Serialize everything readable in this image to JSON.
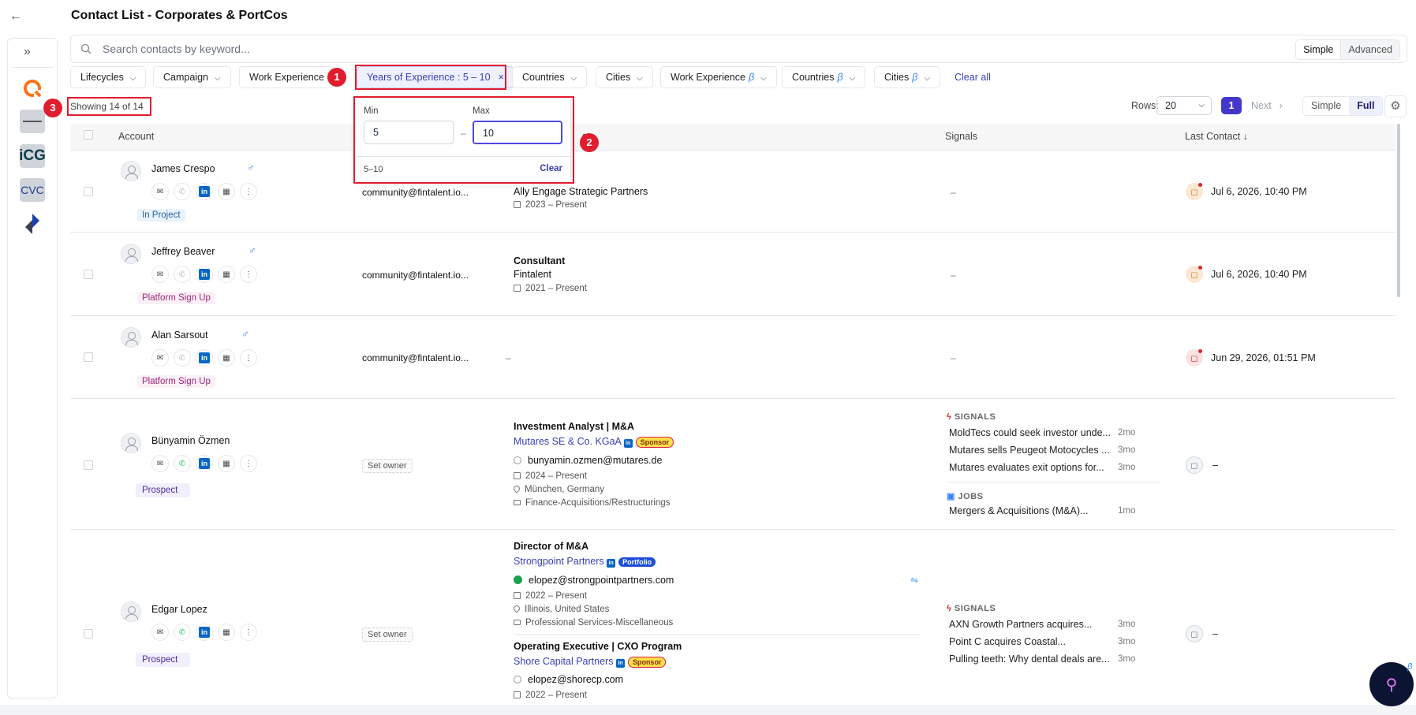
{
  "header": {
    "title": "Contact List - Corporates & PortCos",
    "back_icon": "arrow-left-icon"
  },
  "rail": {
    "expand_icon": "double-chevron-right-icon",
    "logos": [
      "app-logo",
      "portco-logo",
      "iCG",
      "CVC",
      "diamond-logo"
    ]
  },
  "search": {
    "placeholder": "Search contacts by keyword...",
    "mode_simple": "Simple",
    "mode_advanced": "Advanced"
  },
  "filters": {
    "lifecycles": "Lifecycles",
    "campaign": "Campaign",
    "work_experience": "Work Experience",
    "years": "Years of Experience : 5 – 10",
    "countries": "Countries",
    "cities": "Cities",
    "work_experience_beta": "Work Experience",
    "countries_beta": "Countries",
    "cities_beta": "Cities",
    "beta": "β",
    "clear_all": "Clear all"
  },
  "annotations": {
    "b1": "1",
    "b2": "2",
    "b3": "3"
  },
  "popover": {
    "min_label": "Min",
    "max_label": "Max",
    "min_value": "5",
    "max_value": "10",
    "range": "5–10",
    "clear": "Clear",
    "dash": "–"
  },
  "toolbar": {
    "showing": "Showing 14 of 14",
    "rows_label": "Rows:",
    "rows_value": "20",
    "page": "1",
    "next": "Next",
    "view_simple": "Simple",
    "view_full": "Full"
  },
  "table": {
    "col_account": "Account",
    "col_signals": "Signals",
    "col_last_contact": "Last Contact ↓",
    "col_position_partial": "s"
  },
  "rows": [
    {
      "name": "James Crespo",
      "tag": "In Project",
      "email": "community@fintalent.io...",
      "company": "Ally Engage Strategic Partners",
      "dates": "2023 – Present",
      "signal": "–",
      "last": "Jul 6, 2026, 10:40 PM"
    },
    {
      "name": "Jeffrey Beaver",
      "tag": "Platform Sign Up",
      "email": "community@fintalent.io...",
      "title": "Consultant",
      "company": "Fintalent",
      "dates": "2021 – Present",
      "signal": "–",
      "last": "Jul 6, 2026, 10:40 PM"
    },
    {
      "name": "Alan Sarsout",
      "tag": "Platform Sign Up",
      "email": "community@fintalent.io...",
      "position": "–",
      "signal": "–",
      "last": "Jun 29, 2026, 01:51 PM"
    },
    {
      "name": "Bünyamin Özmen",
      "tag": "Prospect",
      "owner": "Set owner",
      "title": "Investment Analyst | M&A",
      "company": "Mutares SE & Co. KGaA",
      "badge": "Sponsor",
      "email": "bunyamin.ozmen@mutares.de",
      "dates": "2024 – Present",
      "location": "München, Germany",
      "industry": "Finance-Acquisitions/Restructurings",
      "signals_head": "SIGNALS",
      "signals": [
        {
          "t": "MoldTecs could seek investor unde...",
          "a": "2mo"
        },
        {
          "t": "Mutares sells Peugeot Motocycles ...",
          "a": "3mo"
        },
        {
          "t": "Mutares evaluates exit options for...",
          "a": "3mo"
        }
      ],
      "jobs_head": "JOBS",
      "jobs": [
        {
          "t": "Mergers & Acquisitions (M&A)...",
          "a": "1mo"
        }
      ],
      "last": "–"
    },
    {
      "name": "Edgar Lopez",
      "tag": "Prospect",
      "owner": "Set owner",
      "title": "Director of M&A",
      "company": "Strongpoint Partners",
      "badge": "Portfolio",
      "email": "elopez@strongpointpartners.com",
      "dates": "2022 – Present",
      "location": "Illinois, United States",
      "industry": "Professional Services-Miscellaneous",
      "title2": "Operating Executive | CXO Program",
      "company2": "Shore Capital Partners",
      "badge2": "Sponsor",
      "email2": "elopez@shorecp.com",
      "dates2": "2022 – Present",
      "signals_head": "SIGNALS",
      "signals": [
        {
          "t": "AXN Growth Partners acquires...",
          "a": "3mo"
        },
        {
          "t": "Point C acquires Coastal...",
          "a": "3mo"
        },
        {
          "t": "Pulling teeth: Why dental deals are...",
          "a": "3mo"
        }
      ],
      "last": "–"
    }
  ],
  "colors": {
    "accent": "#4338ca",
    "highlight": "#e11d2e"
  }
}
